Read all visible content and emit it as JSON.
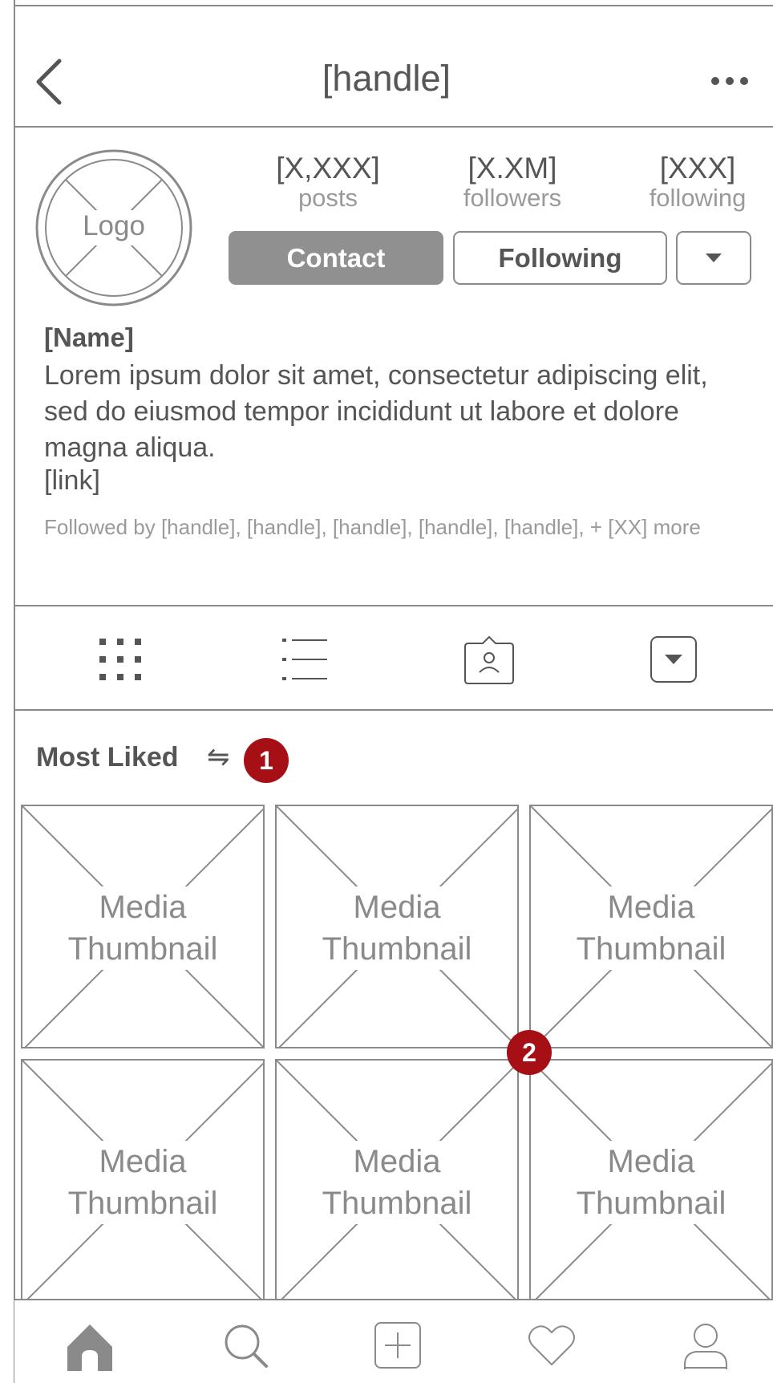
{
  "header": {
    "title": "[handle]"
  },
  "profile": {
    "logo_label": "Logo",
    "stats": [
      {
        "value": "[X,XXX]",
        "label": "posts"
      },
      {
        "value": "[X.XM]",
        "label": "followers"
      },
      {
        "value": "[XXX]",
        "label": "following"
      }
    ],
    "contact_label": "Contact",
    "following_label": "Following"
  },
  "bio": {
    "name": "[Name]",
    "text": "Lorem ipsum dolor sit amet, consectetur adipiscing elit, sed do eiusmod tempor incididunt ut labore et dolore magna aliqua.",
    "link": "[link]",
    "followed_by": "Followed by [handle], [handle], [handle], [handle], [handle], + [XX] more"
  },
  "section": {
    "title": "Most Liked",
    "sort_glyph": "⇋",
    "badge_1": "1",
    "badge_2": "2"
  },
  "grid": {
    "items": [
      {
        "line1": "Media",
        "line2": "Thumbnail"
      },
      {
        "line1": "Media",
        "line2": "Thumbnail"
      },
      {
        "line1": "Media",
        "line2": "Thumbnail"
      },
      {
        "line1": "Media",
        "line2": "Thumbnail"
      },
      {
        "line1": "Media",
        "line2": "Thumbnail"
      },
      {
        "line1": "Media",
        "line2": "Thumbnail"
      }
    ]
  },
  "icons": {
    "back": "chevron-left-icon",
    "more": "more-horizontal-icon",
    "tabs": [
      "grid-icon",
      "list-icon",
      "tagged-icon",
      "dropdown-icon"
    ],
    "nav": [
      "home-icon",
      "search-icon",
      "add-icon",
      "heart-icon",
      "profile-icon"
    ]
  },
  "colors": {
    "wire": "#8a8a8a",
    "text": "#555555",
    "badge": "#a50f15",
    "button_fill": "#909090"
  }
}
